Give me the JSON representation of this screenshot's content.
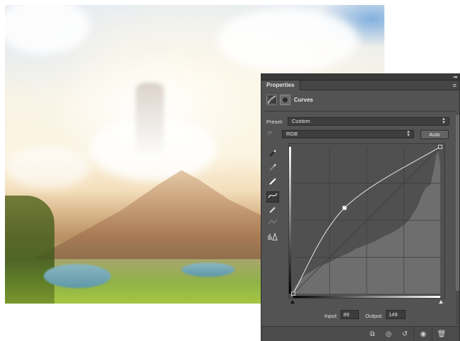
{
  "panel": {
    "tab_label": "Properties",
    "title": "Curves",
    "preset_label": "Preset:",
    "preset_value": "Custom",
    "channel_value": "RGB",
    "auto_button": "Auto",
    "input_label": "Input:",
    "input_value": "89",
    "output_label": "Output:",
    "output_value": "149"
  },
  "curve": {
    "points": [
      [
        0,
        0
      ],
      [
        89,
        149
      ],
      [
        255,
        255
      ]
    ],
    "active_point": [
      89,
      149
    ]
  },
  "tools": [
    {
      "name": "sample-black-point-icon"
    },
    {
      "name": "sample-gray-point-icon"
    },
    {
      "name": "sample-white-point-icon"
    },
    {
      "name": "edit-points-curve-icon"
    },
    {
      "name": "draw-curve-pencil-icon"
    },
    {
      "name": "smooth-curve-icon"
    },
    {
      "name": "clipping-warning-icon"
    }
  ],
  "bottom_icons": [
    {
      "name": "clip-to-layer-icon"
    },
    {
      "name": "view-previous-state-icon"
    },
    {
      "name": "reset-icon"
    },
    {
      "name": "toggle-visibility-icon"
    },
    {
      "name": "delete-icon"
    }
  ]
}
